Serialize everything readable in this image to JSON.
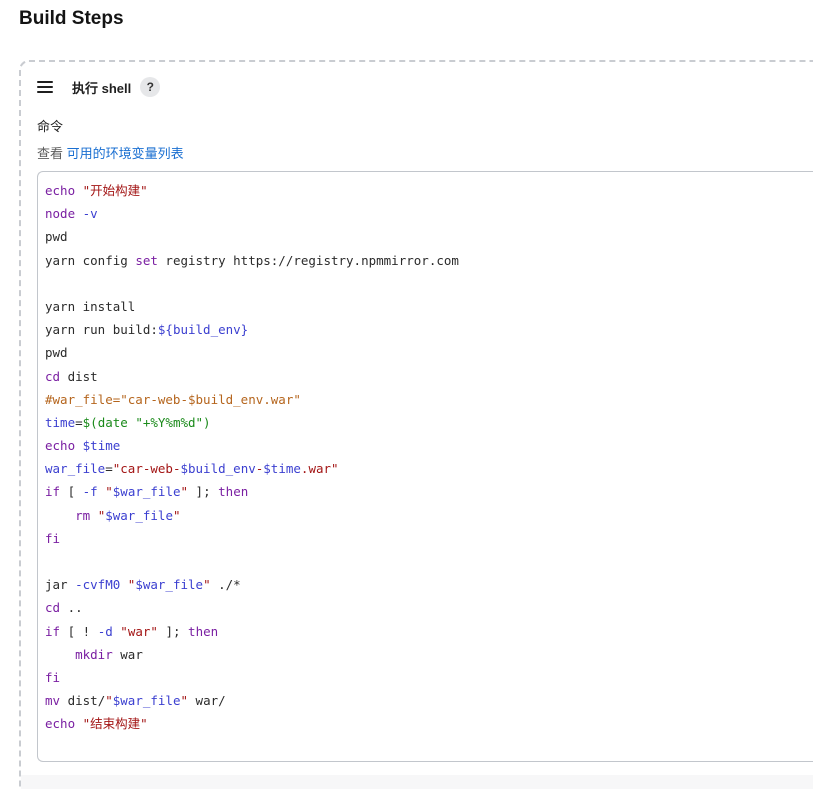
{
  "section": {
    "title": "Build Steps"
  },
  "step": {
    "name": "执行 shell",
    "help_label": "?",
    "field_label": "命令",
    "env_prefix": "查看",
    "env_link": "可用的环境变量列表"
  },
  "editor": {
    "lines": [
      [
        {
          "t": "echo",
          "c": "kw"
        },
        {
          "t": " "
        },
        {
          "t": "\"开始构建\"",
          "c": "str"
        }
      ],
      [
        {
          "t": "node",
          "c": "kw"
        },
        {
          "t": " "
        },
        {
          "t": "-v",
          "c": "bi"
        }
      ],
      [
        {
          "t": "pwd"
        }
      ],
      [
        {
          "t": "yarn config "
        },
        {
          "t": "set",
          "c": "kw"
        },
        {
          "t": " registry https://registry.npmmirror.com"
        }
      ],
      [],
      [
        {
          "t": "yarn install"
        }
      ],
      [
        {
          "t": "yarn run build:"
        },
        {
          "t": "${build_env}",
          "c": "bi"
        }
      ],
      [
        {
          "t": "pwd"
        }
      ],
      [
        {
          "t": "cd",
          "c": "kw"
        },
        {
          "t": " dist"
        }
      ],
      [
        {
          "t": "#war_file=\"car-web-$build_env.war\"",
          "c": "cmt"
        }
      ],
      [
        {
          "t": "time",
          "c": "bi"
        },
        {
          "t": "="
        },
        {
          "t": "$(date \"+%Y%m%d\")",
          "c": "grn"
        }
      ],
      [
        {
          "t": "echo",
          "c": "kw"
        },
        {
          "t": " "
        },
        {
          "t": "$time",
          "c": "bi"
        }
      ],
      [
        {
          "t": "war_file",
          "c": "bi"
        },
        {
          "t": "="
        },
        {
          "t": "\"car-web-",
          "c": "str"
        },
        {
          "t": "$build_env",
          "c": "bi"
        },
        {
          "t": "-",
          "c": "str"
        },
        {
          "t": "$time",
          "c": "bi"
        },
        {
          "t": ".war\"",
          "c": "str"
        }
      ],
      [
        {
          "t": "if",
          "c": "kw"
        },
        {
          "t": " [ "
        },
        {
          "t": "-f",
          "c": "bi"
        },
        {
          "t": " "
        },
        {
          "t": "\"",
          "c": "str"
        },
        {
          "t": "$war_file",
          "c": "bi"
        },
        {
          "t": "\"",
          "c": "str"
        },
        {
          "t": " ]; "
        },
        {
          "t": "then",
          "c": "kw"
        }
      ],
      [
        {
          "t": "    "
        },
        {
          "t": "rm",
          "c": "kw"
        },
        {
          "t": " "
        },
        {
          "t": "\"",
          "c": "str"
        },
        {
          "t": "$war_file",
          "c": "bi"
        },
        {
          "t": "\"",
          "c": "str"
        }
      ],
      [
        {
          "t": "fi",
          "c": "kw"
        }
      ],
      [],
      [
        {
          "t": "jar "
        },
        {
          "t": "-cvfM0",
          "c": "bi"
        },
        {
          "t": " "
        },
        {
          "t": "\"",
          "c": "str"
        },
        {
          "t": "$war_file",
          "c": "bi"
        },
        {
          "t": "\"",
          "c": "str"
        },
        {
          "t": " ./*"
        }
      ],
      [
        {
          "t": "cd",
          "c": "kw"
        },
        {
          "t": " .."
        }
      ],
      [
        {
          "t": "if",
          "c": "kw"
        },
        {
          "t": " [ ! "
        },
        {
          "t": "-d",
          "c": "bi"
        },
        {
          "t": " "
        },
        {
          "t": "\"war\"",
          "c": "str"
        },
        {
          "t": " ]; "
        },
        {
          "t": "then",
          "c": "kw"
        }
      ],
      [
        {
          "t": "    "
        },
        {
          "t": "mkdir",
          "c": "kw"
        },
        {
          "t": " war"
        }
      ],
      [
        {
          "t": "fi",
          "c": "kw"
        }
      ],
      [
        {
          "t": "mv",
          "c": "kw"
        },
        {
          "t": " dist/"
        },
        {
          "t": "\"",
          "c": "str"
        },
        {
          "t": "$war_file",
          "c": "bi"
        },
        {
          "t": "\"",
          "c": "str"
        },
        {
          "t": " war/"
        }
      ],
      [
        {
          "t": "echo",
          "c": "kw"
        },
        {
          "t": " "
        },
        {
          "t": "\"结束构建\"",
          "c": "str"
        }
      ]
    ]
  }
}
